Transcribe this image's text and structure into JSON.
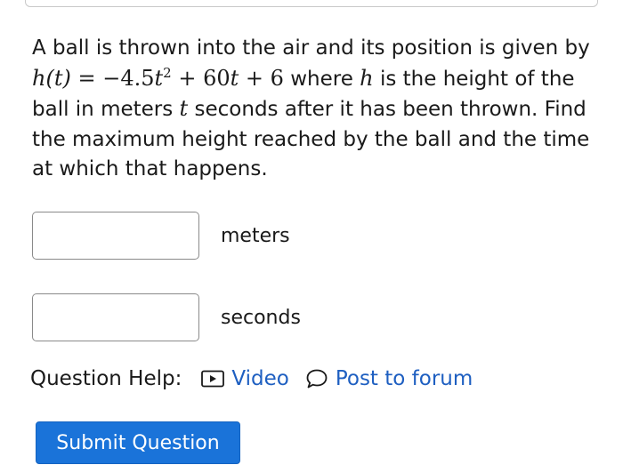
{
  "question": {
    "line1": "A ball is thrown into the air and its position is given by",
    "equation": {
      "lhs": "h(t)",
      "equals": "=",
      "rhs_pre": "−4.5",
      "rhs_var": "t",
      "rhs_exp": "2",
      "rhs_post": " + 60",
      "rhs_var2": "t",
      "rhs_const": " + 6"
    },
    "line2_after": " where ",
    "var_h": "h",
    "line2_tail": " is the height of the",
    "line3_pre": "ball in meters ",
    "var_t": "t",
    "line3_post": " seconds after it has been thrown. Find",
    "line4": "the maximum height reached by the ball and the time",
    "line5": "at which that happens."
  },
  "answers": [
    {
      "value": "",
      "unit": "meters"
    },
    {
      "value": "",
      "unit": "seconds"
    }
  ],
  "help": {
    "label": "Question Help:",
    "video_label": "Video",
    "forum_label": "Post to forum"
  },
  "submit_label": "Submit Question",
  "colors": {
    "link": "#1e5fc1",
    "button": "#1a73d9"
  },
  "icons": {
    "video": "play-box-icon",
    "forum": "speech-bubble-icon"
  }
}
